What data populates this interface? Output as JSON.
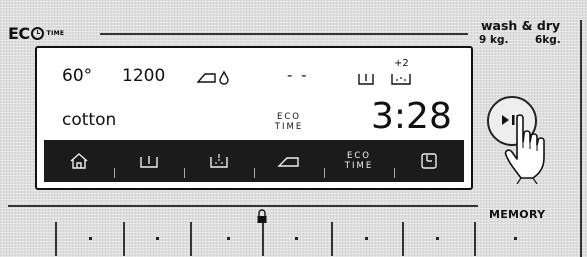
{
  "brand": {
    "eco_text": "EC",
    "time_text": "TIME"
  },
  "product": {
    "line1": "wash & dry",
    "capacity_wash": "9 kg.",
    "capacity_dry": "6kg."
  },
  "display": {
    "temperature": "60°",
    "spin_speed": "1200",
    "dashes": "- -",
    "dose_plus": "+2",
    "program_name": "cotton",
    "eco_time_line1": "ECO",
    "eco_time_line2": "TIME",
    "remaining_time": "3:28"
  },
  "function_bar": {
    "items": [
      {
        "icon": "home-icon"
      },
      {
        "icon": "spin-icon"
      },
      {
        "icon": "soil-level-icon"
      },
      {
        "icon": "iron-icon"
      },
      {
        "icon": "eco-time-icon",
        "line1": "ECO",
        "line2": "TIME"
      },
      {
        "icon": "delay-timer-icon"
      }
    ]
  },
  "start_button": {
    "icon": "play-pause-icon",
    "hand_icon": "hand-pointer-icon"
  },
  "memory": {
    "label": "MEMORY"
  },
  "child_lock": {
    "icon": "lock-icon"
  }
}
